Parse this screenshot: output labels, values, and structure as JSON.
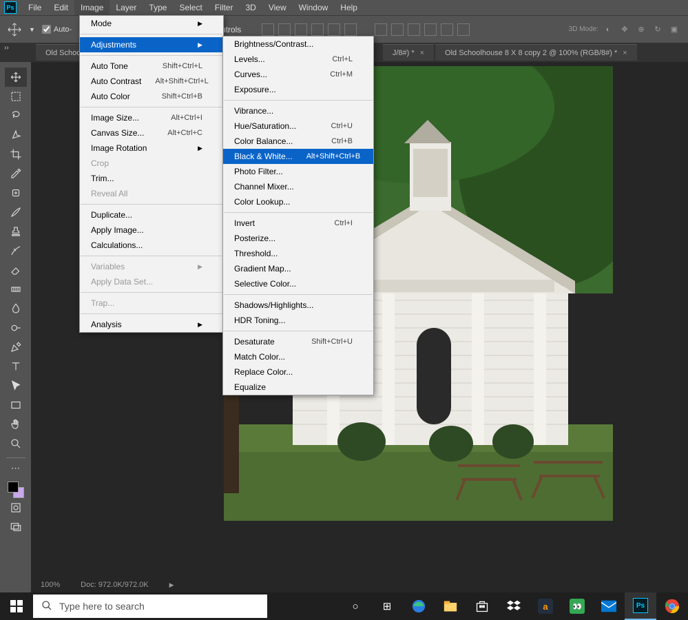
{
  "menubar": [
    "File",
    "Edit",
    "Image",
    "Layer",
    "Type",
    "Select",
    "Filter",
    "3D",
    "View",
    "Window",
    "Help"
  ],
  "menubar_selected": 2,
  "optbar": {
    "auto": "Auto-",
    "controls": "ontrols",
    "threed": "3D Mode:"
  },
  "tabs": [
    {
      "label": "Old School"
    },
    {
      "label": "J/8#) *"
    },
    {
      "label": "Old Schoolhouse 8 X 8 copy 2 @ 100% (RGB/8#) *"
    }
  ],
  "image_menu": {
    "mode": "Mode",
    "adjustments": "Adjustments",
    "auto_tone": {
      "l": "Auto Tone",
      "s": "Shift+Ctrl+L"
    },
    "auto_contrast": {
      "l": "Auto Contrast",
      "s": "Alt+Shift+Ctrl+L"
    },
    "auto_color": {
      "l": "Auto Color",
      "s": "Shift+Ctrl+B"
    },
    "image_size": {
      "l": "Image Size...",
      "s": "Alt+Ctrl+I"
    },
    "canvas_size": {
      "l": "Canvas Size...",
      "s": "Alt+Ctrl+C"
    },
    "image_rotation": "Image Rotation",
    "crop": "Crop",
    "trim": "Trim...",
    "reveal_all": "Reveal All",
    "duplicate": "Duplicate...",
    "apply_image": "Apply Image...",
    "calculations": "Calculations...",
    "variables": "Variables",
    "apply_data": "Apply Data Set...",
    "trap": "Trap...",
    "analysis": "Analysis"
  },
  "adjustments_menu": {
    "brightness": "Brightness/Contrast...",
    "levels": {
      "l": "Levels...",
      "s": "Ctrl+L"
    },
    "curves": {
      "l": "Curves...",
      "s": "Ctrl+M"
    },
    "exposure": "Exposure...",
    "vibrance": "Vibrance...",
    "hue": {
      "l": "Hue/Saturation...",
      "s": "Ctrl+U"
    },
    "color_balance": {
      "l": "Color Balance...",
      "s": "Ctrl+B"
    },
    "bw": {
      "l": "Black & White...",
      "s": "Alt+Shift+Ctrl+B"
    },
    "photo_filter": "Photo Filter...",
    "channel_mixer": "Channel Mixer...",
    "color_lookup": "Color Lookup...",
    "invert": {
      "l": "Invert",
      "s": "Ctrl+I"
    },
    "posterize": "Posterize...",
    "threshold": "Threshold...",
    "gradient_map": "Gradient Map...",
    "selective": "Selective Color...",
    "shadows": "Shadows/Highlights...",
    "hdr": "HDR Toning...",
    "desaturate": {
      "l": "Desaturate",
      "s": "Shift+Ctrl+U"
    },
    "match": "Match Color...",
    "replace": "Replace Color...",
    "equalize": "Equalize"
  },
  "status": {
    "zoom": "100%",
    "doc": "Doc: 972.0K/972.0K"
  },
  "taskbar": {
    "search_placeholder": "Type here to search"
  }
}
